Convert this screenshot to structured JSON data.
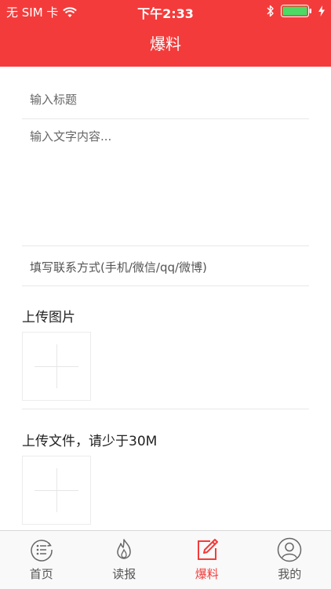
{
  "status_bar": {
    "carrier": "无 SIM 卡",
    "time": "下午2:33"
  },
  "header": {
    "title": "爆料"
  },
  "form": {
    "title_placeholder": "输入标题",
    "content_placeholder": "输入文字内容...",
    "contact_placeholder": "填写联系方式(手机/微信/qq/微博)",
    "upload_image_label": "上传图片",
    "upload_file_label": "上传文件，请少于30M"
  },
  "tabbar": {
    "items": [
      {
        "label": "首页",
        "icon": "home-list-icon"
      },
      {
        "label": "读报",
        "icon": "flame-icon"
      },
      {
        "label": "爆料",
        "icon": "edit-icon",
        "active": true
      },
      {
        "label": "我的",
        "icon": "user-icon"
      }
    ]
  },
  "colors": {
    "accent": "#f43b3b",
    "battery": "#4cd964"
  }
}
